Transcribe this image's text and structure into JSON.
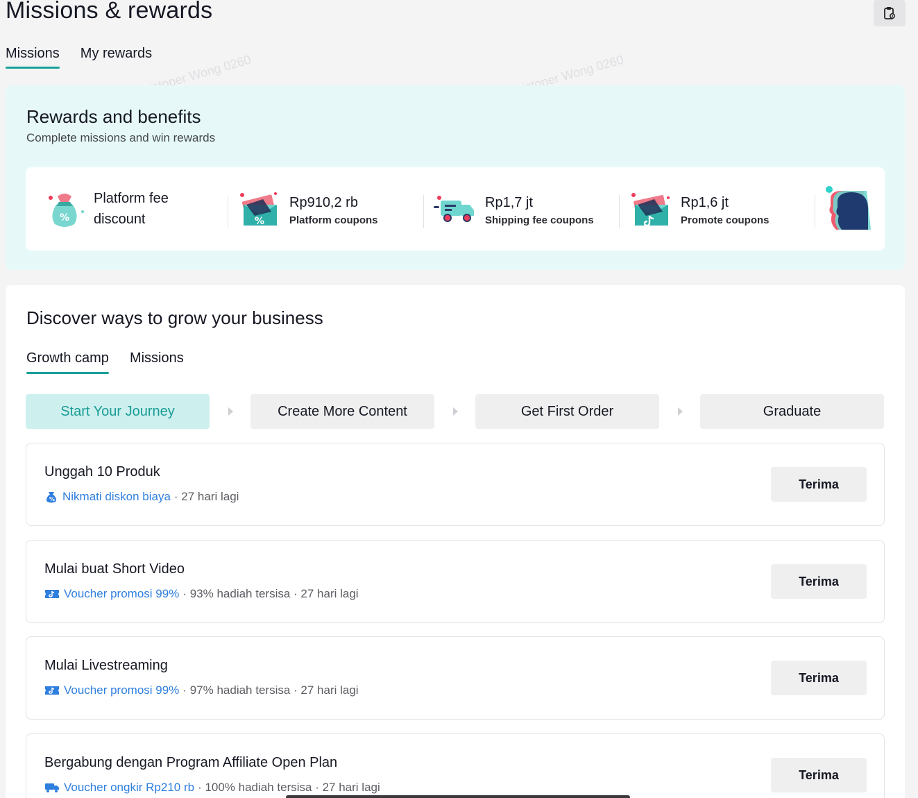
{
  "page": {
    "title": "Missions & rewards"
  },
  "top_tabs": [
    {
      "label": "Missions",
      "active": true
    },
    {
      "label": "My rewards",
      "active": false
    }
  ],
  "rewards": {
    "title": "Rewards and benefits",
    "subtitle": "Complete missions and win rewards",
    "items": [
      {
        "line1": "Platform fee",
        "line2": "discount",
        "icon": "money-bag-percent-icon"
      },
      {
        "value": "Rp910,2 rb",
        "label": "Platform coupons",
        "icon": "percent-coupon-icon"
      },
      {
        "value": "Rp1,7 jt",
        "label": "Shipping fee coupons",
        "icon": "delivery-truck-icon"
      },
      {
        "value": "Rp1,6 jt",
        "label": "Promote coupons",
        "icon": "tiktok-coupon-icon"
      }
    ]
  },
  "grow": {
    "title": "Discover ways to grow your business",
    "tabs": [
      {
        "label": "Growth camp",
        "active": true
      },
      {
        "label": "Missions",
        "active": false
      }
    ],
    "steps": [
      "Start Your Journey",
      "Create More Content",
      "Get First Order",
      "Graduate"
    ],
    "missions": [
      {
        "title": "Unggah 10 Produk",
        "reward": "Nikmati diskon biaya",
        "rest": "· 27 hari lagi",
        "icon": "money-bag-icon",
        "button": "Terima"
      },
      {
        "title": "Mulai buat Short Video",
        "reward": "Voucher promosi 99%",
        "rest": "· 93% hadiah tersisa · 27 hari lagi",
        "icon": "tiktok-voucher-icon",
        "button": "Terima"
      },
      {
        "title": "Mulai Livestreaming",
        "reward": "Voucher promosi 99%",
        "rest": "· 97% hadiah tersisa · 27 hari lagi",
        "icon": "tiktok-voucher-icon",
        "button": "Terima"
      },
      {
        "title": "Bergabung dengan Program Affiliate Open Plan",
        "reward": "Voucher ongkir Rp210 rb",
        "rest": "· 100% hadiah tersisa · 27 hari lagi",
        "icon": "truck-icon",
        "button": "Terima"
      }
    ]
  },
  "watermark": "Christoper Wong 0260",
  "colors": {
    "accent": "#1aa19a",
    "link": "#2f7fde",
    "rewards_bg": "#e6f9f8"
  }
}
